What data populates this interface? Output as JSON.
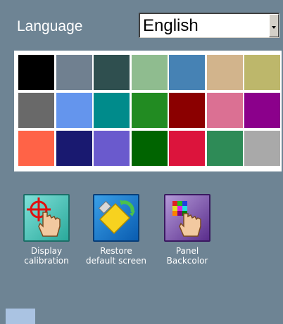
{
  "language": {
    "label": "Language",
    "selected": "English"
  },
  "palette": {
    "rows": [
      [
        "#000000",
        "#708090",
        "#2f4f4f",
        "#8fbc8f",
        "#4682b4",
        "#d2b48c",
        "#bdb76b"
      ],
      [
        "#696969",
        "#6495ed",
        "#008b8b",
        "#228b22",
        "#8b0000",
        "#db7093",
        "#8b008b"
      ],
      [
        "#ff6347",
        "#191970",
        "#6a5acd",
        "#006400",
        "#dc143c",
        "#2e8b57",
        "#a9a9a9"
      ]
    ]
  },
  "tools": [
    {
      "label": "Display\ncalibration",
      "icon": "calibration-icon"
    },
    {
      "label": "Restore\ndefault screen",
      "icon": "restore-screen-icon"
    },
    {
      "label": "Panel\nBackcolor",
      "icon": "panel-backcolor-icon"
    }
  ]
}
